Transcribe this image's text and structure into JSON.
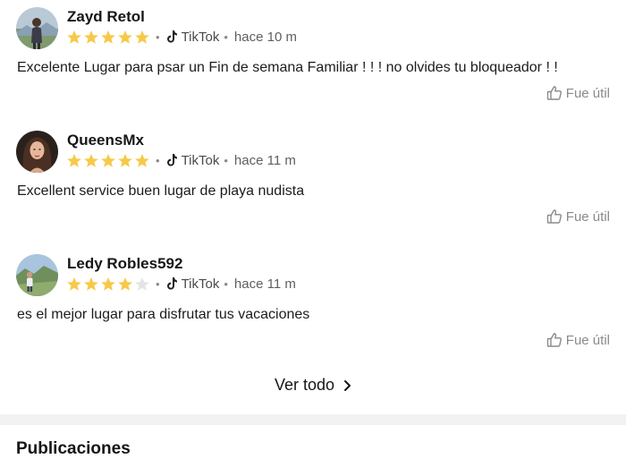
{
  "reviews": [
    {
      "author": "Zayd Retol",
      "rating": 5,
      "max_rating": 5,
      "source": "TikTok",
      "time": "hace 10 m",
      "text": "Excelente Lugar para psar un Fin de semana Familiar ! ! ! no olvides tu bloqueador ! !",
      "useful_label": "Fue útil"
    },
    {
      "author": "QueensMx",
      "rating": 5,
      "max_rating": 5,
      "source": "TikTok",
      "time": "hace 11 m",
      "text": "Excellent service buen lugar de playa nudista",
      "useful_label": "Fue útil"
    },
    {
      "author": "Ledy Robles592",
      "rating": 4,
      "max_rating": 5,
      "source": "TikTok",
      "time": "hace 11 m",
      "text": "es el mejor lugar para disfrutar tus vacaciones",
      "useful_label": "Fue útil"
    }
  ],
  "see_all_label": "Ver todo",
  "next_section_title": "Publicaciones",
  "colors": {
    "star_filled": "#F7C948",
    "star_empty": "#E4E4E4",
    "muted_text": "#8A8A8A"
  }
}
